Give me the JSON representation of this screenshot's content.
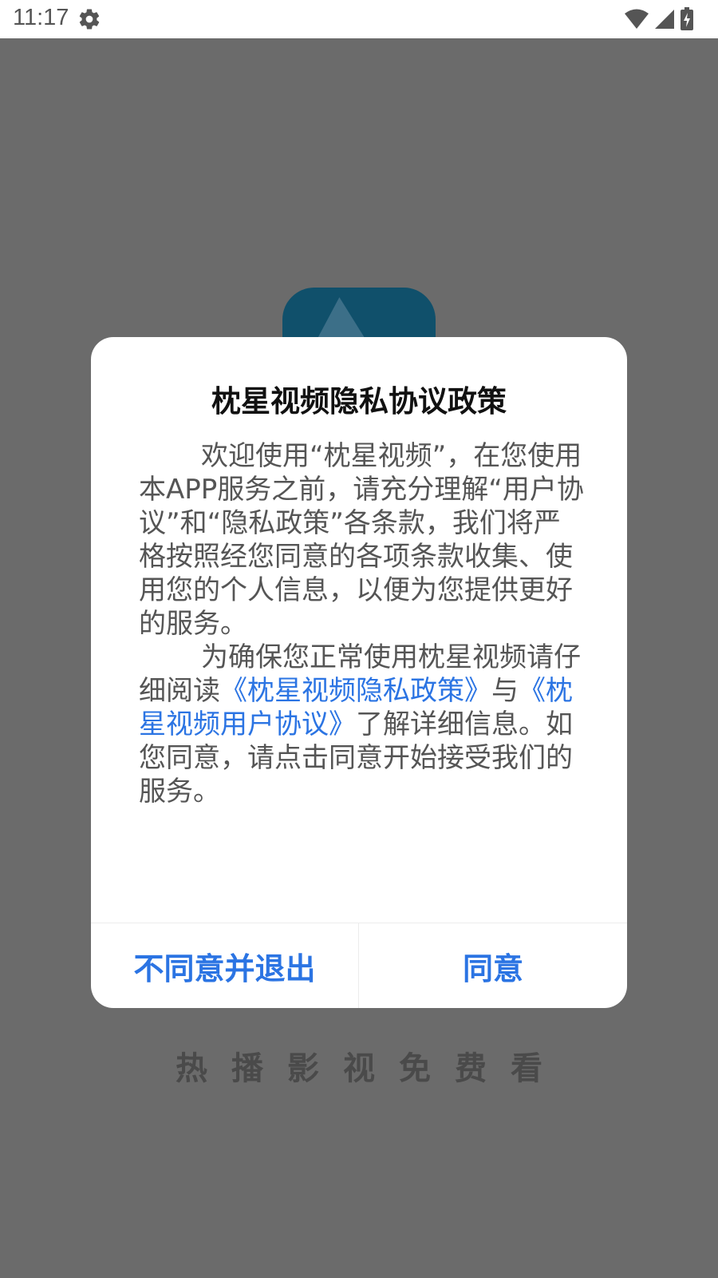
{
  "status_bar": {
    "time": "11:17",
    "icons": [
      "settings-gear-icon",
      "wifi-icon",
      "cellular-signal-icon",
      "battery-charging-icon"
    ]
  },
  "background": {
    "slogan": "热播影视免费看",
    "logo": "app-logo-play-icon"
  },
  "dialog": {
    "title": "枕星视频隐私协议政策",
    "para1": "欢迎使用“枕星视频”，在您使用本APP服务之前，请充分理解“用户协议”和“隐私政策”各条款，我们将严格按照经您同意的各项条款收集、使用您的个人信息，以便为您提供更好的服务。",
    "para2_prefix": "为确保您正常使用枕星视频请仔细阅读",
    "privacy_link": "《枕星视频隐私政策》",
    "para2_mid": "与",
    "agreement_link": "《枕星视频用户协议》",
    "para2_suffix": "了解详细信息。如您同意，请点击同意开始接受我们的服务。",
    "decline_button": "不同意并退出",
    "agree_button": "同意"
  },
  "colors": {
    "accent": "#2b74e3",
    "overlay": "#6b6b6b"
  }
}
